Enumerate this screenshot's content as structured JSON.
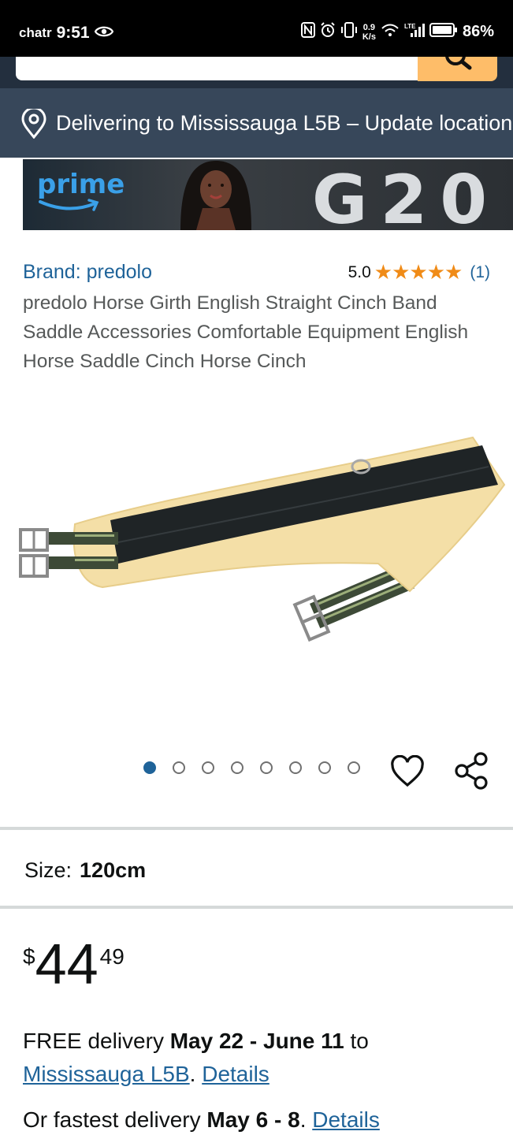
{
  "status_bar": {
    "carrier": "chatr",
    "time": "9:51",
    "net_speed_value": "0.9",
    "net_speed_unit": "K/s",
    "signal_label": "LTE",
    "battery": "86%"
  },
  "location": {
    "text": "Delivering to Mississauga L5B – Update location"
  },
  "banner": {
    "logo_text": "prime",
    "title": "G20"
  },
  "product": {
    "brand": "Brand: predolo",
    "rating_value": "5.0",
    "stars": "★★★★★",
    "rating_count": "(1)",
    "title": "predolo Horse Girth English Straight Cinch Band Saddle Accessories Comfortable Equipment English Horse Saddle Cinch Horse Cinch",
    "image_count": 8,
    "active_image_index": 0
  },
  "size": {
    "label": "Size:",
    "value": "120cm"
  },
  "price": {
    "symbol": "$",
    "whole": "44",
    "fraction": "49"
  },
  "delivery": {
    "prefix": "FREE delivery ",
    "dates": "May 22 - June 11",
    "to": " to",
    "location_link": "Mississauga L5B",
    "separator": ". ",
    "details_link": "Details"
  },
  "fastest": {
    "prefix": "Or fastest delivery ",
    "dates": "May 6 - 8",
    "separator": ". ",
    "details_link": "Details"
  },
  "colors": {
    "header_dark": "#232f3e",
    "location_bar": "#37475a",
    "search_button": "#febd69",
    "link": "#1f6399",
    "star": "#f08b17"
  }
}
